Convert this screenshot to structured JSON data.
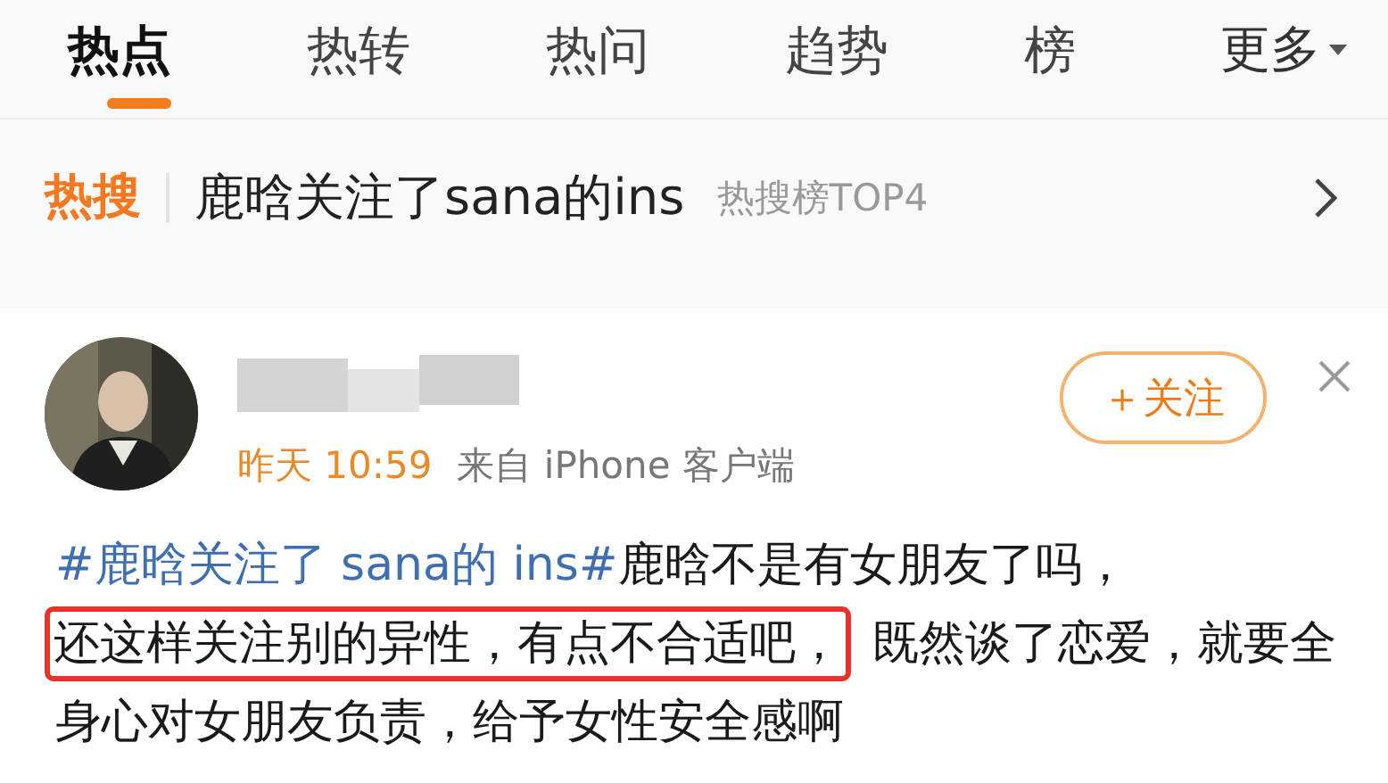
{
  "tabs": [
    {
      "label": "热点",
      "selected": true
    },
    {
      "label": "热转",
      "selected": false
    },
    {
      "label": "热问",
      "selected": false
    },
    {
      "label": "趋势",
      "selected": false
    },
    {
      "label": "榜",
      "selected": false
    }
  ],
  "more": {
    "label": "更多"
  },
  "hot_search": {
    "badge": "热搜",
    "title": "鹿晗关注了sana的ins",
    "rank": "热搜榜TOP4"
  },
  "post": {
    "time": "昨天 10:59",
    "source": "来自 iPhone 客户端",
    "follow": "＋关注",
    "hashtag": "#鹿晗关注了 sana的 ins#",
    "text": "鹿晗不是有女朋友了吗，",
    "highlighted": "还这样关注别的异性，有点不合适吧，",
    "rest": "既然谈了恋爱，就要全身心对女朋友负责，给予女性安全感啊"
  }
}
